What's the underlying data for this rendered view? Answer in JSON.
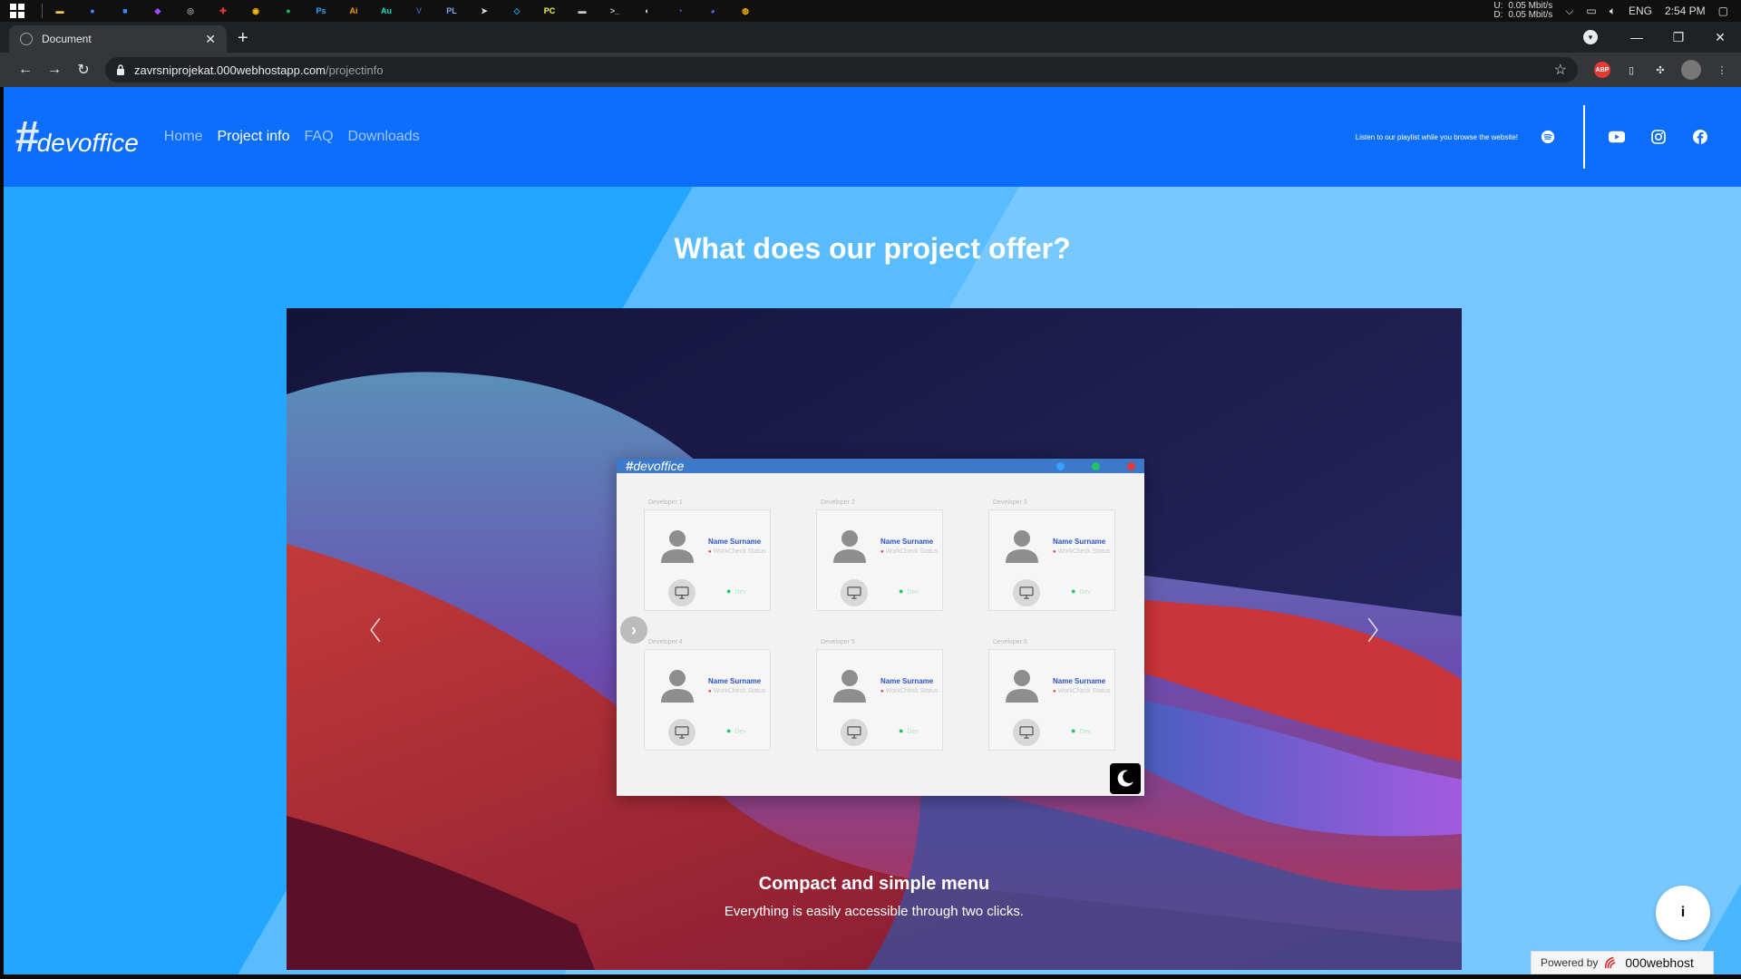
{
  "taskbar": {
    "apps": [
      {
        "icon": "file-explorer-icon",
        "color": "#f7c948",
        "glyph": "▬"
      },
      {
        "icon": "messenger-app-icon",
        "color": "#3f8efc",
        "glyph": "●"
      },
      {
        "icon": "zoom-icon",
        "color": "#2d8cff",
        "glyph": "■"
      },
      {
        "icon": "messenger-icon",
        "color": "#a845ff",
        "glyph": "◆"
      },
      {
        "icon": "clock-app-icon",
        "color": "#999999",
        "glyph": "◎"
      },
      {
        "icon": "app-red-icon",
        "color": "#e53935",
        "glyph": "✚"
      },
      {
        "icon": "chrome-icon",
        "color": "#fbbc04",
        "glyph": "◉"
      },
      {
        "icon": "spotify-icon",
        "color": "#1db954",
        "glyph": "●"
      },
      {
        "icon": "photoshop-icon",
        "color": "#31a8ff",
        "glyph": "Ps"
      },
      {
        "icon": "illustrator-icon",
        "color": "#ff9a00",
        "glyph": "Ai"
      },
      {
        "icon": "audition-icon",
        "color": "#00e4bb",
        "glyph": "Au"
      },
      {
        "icon": "visio-icon",
        "color": "#3955a3",
        "glyph": "V"
      },
      {
        "icon": "pl-app-icon",
        "color": "#7aa7ff",
        "glyph": "PL"
      },
      {
        "icon": "cursor-app-icon",
        "color": "#dddddd",
        "glyph": "➤"
      },
      {
        "icon": "vscode-icon",
        "color": "#23a9f2",
        "glyph": "◇"
      },
      {
        "icon": "pycharm-icon",
        "color": "#fcf84a",
        "glyph": "PC"
      },
      {
        "icon": "app-bar-icon",
        "color": "#cccccc",
        "glyph": "▬"
      },
      {
        "icon": "terminal-icon",
        "color": "#cccccc",
        "glyph": ">_"
      },
      {
        "icon": "steam-icon",
        "color": "#cfd8e3",
        "glyph": "◐"
      },
      {
        "icon": "viber-icon",
        "color": "#7360f2",
        "glyph": "◔"
      },
      {
        "icon": "discord-icon",
        "color": "#5865f2",
        "glyph": "◕"
      },
      {
        "icon": "app-misc-icon",
        "color": "#f4b400",
        "glyph": "◍"
      }
    ],
    "net_up_label": "U:",
    "net_down_label": "D:",
    "net_up": "0.05 Mbit/s",
    "net_down": "0.05 Mbit/s",
    "language": "ENG",
    "time": "2:54 PM"
  },
  "browser": {
    "tab_title": "Document",
    "tab_close": "✕",
    "new_tab": "+",
    "url_host": "zavrsniprojekat.000webhostapp.com",
    "url_path": "/projectinfo",
    "win_minimize": "—",
    "win_restore": "❐",
    "win_close": "✕"
  },
  "site": {
    "logo_hash": "#",
    "logo_word": "devoffice",
    "nav": [
      {
        "label": "Home",
        "active": false
      },
      {
        "label": "Project info",
        "active": true
      },
      {
        "label": "FAQ",
        "active": false
      },
      {
        "label": "Downloads",
        "active": false
      }
    ],
    "playlist_text": "Listen to our playlist while you browse the website!",
    "heading": "What does our project offer?",
    "slide": {
      "title": "Compact and simple menu",
      "subtitle": "Everything is easily accessible through two clicks."
    },
    "mock": {
      "logo_hash": "#",
      "logo_word": "devoffice",
      "dot_colors": [
        "#3aa0ff",
        "#22c55e",
        "#e53935"
      ],
      "cards": [
        {
          "label": "Developer 1",
          "name": "Name Surname",
          "status": "WorkCheck Status",
          "online": "Dev"
        },
        {
          "label": "Developer 2",
          "name": "Name Surname",
          "status": "WorkCheck Status",
          "online": "Dev"
        },
        {
          "label": "Developer 3",
          "name": "Name Surname",
          "status": "WorkCheck Status",
          "online": "Dev"
        },
        {
          "label": "Developer 4",
          "name": "Name Surname",
          "status": "WorkCheck Status",
          "online": "Dev"
        },
        {
          "label": "Developer 5",
          "name": "Name Surname",
          "status": "WorkCheck Status",
          "online": "Dev"
        },
        {
          "label": "Developer 6",
          "name": "Name Surname",
          "status": "WorkCheck Status",
          "online": "Dev"
        }
      ]
    },
    "info_button": "i",
    "powered_by": "Powered by",
    "powered_brand": "000webhost"
  },
  "colors": {
    "site_nav": "#0d6efd",
    "page_bg": "#22a6ff"
  }
}
